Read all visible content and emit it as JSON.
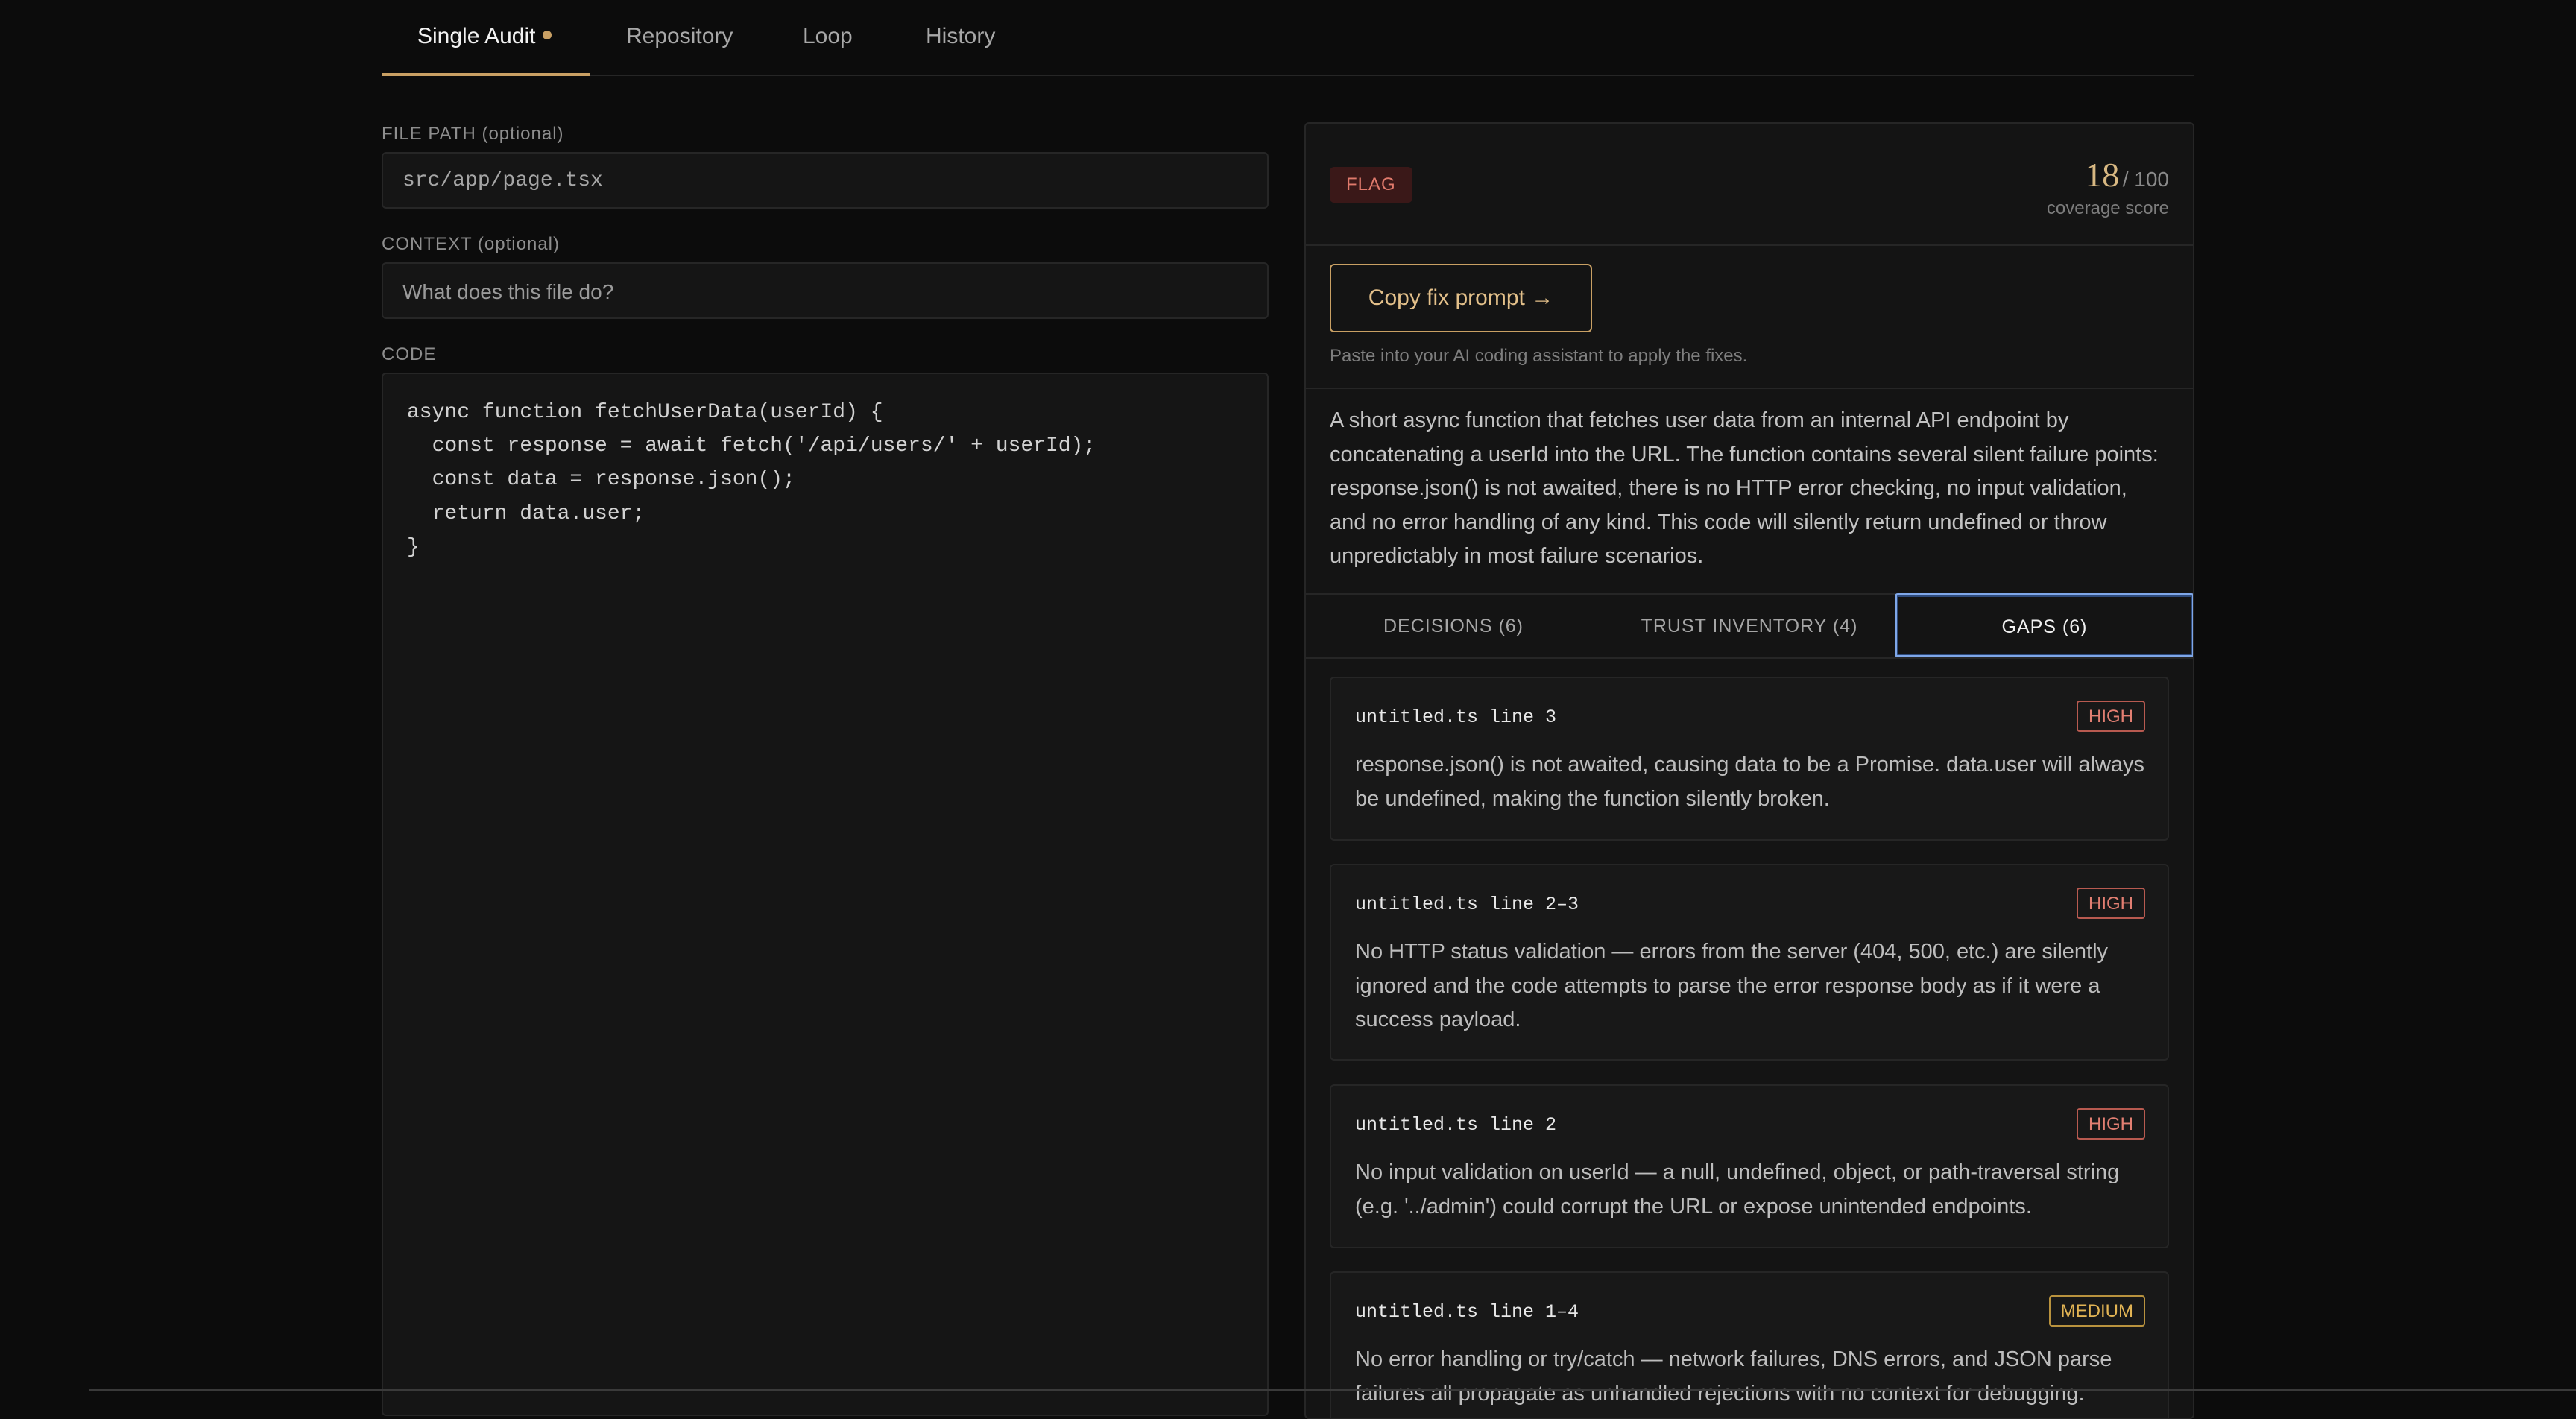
{
  "tabs": [
    {
      "label": "Single Audit",
      "active": true,
      "dot": true
    },
    {
      "label": "Repository"
    },
    {
      "label": "Loop"
    },
    {
      "label": "History"
    }
  ],
  "file_path": {
    "label": "FILE PATH (optional)",
    "value": "src/app/page.tsx"
  },
  "context": {
    "label": "CONTEXT (optional)",
    "placeholder": "What does this file do?"
  },
  "code": {
    "label": "CODE",
    "lines": [
      "async function fetchUserData(userId) {",
      "  const response = await fetch('/api/users/' + userId);",
      "  const data = response.json();",
      "  return data.user;",
      "}"
    ]
  },
  "result": {
    "badge": "FLAG",
    "score": "18",
    "score_max": "/ 100",
    "score_label": "coverage score",
    "copy_button": "Copy fix prompt →",
    "copy_hint": "Paste into your AI coding assistant to apply the fixes.",
    "summary": "A short async function that fetches user data from an internal API endpoint by concatenating a userId into the URL. The function contains several silent failure points: response.json() is not awaited, there is no HTTP error checking, no input validation, and no error handling of any kind. This code will silently return undefined or throw unpredictably in most failure scenarios.",
    "sub_tabs": [
      "DECISIONS (6)",
      "TRUST INVENTORY (4)",
      "GAPS (6)"
    ],
    "gaps": [
      {
        "location": "untitled.ts line 3",
        "severity": "HIGH",
        "description": "response.json() is not awaited, causing data to be a Promise. data.user will always be undefined, making the function silently broken."
      },
      {
        "location": "untitled.ts line 2–3",
        "severity": "HIGH",
        "description": "No HTTP status validation — errors from the server (404, 500, etc.) are silently ignored and the code attempts to parse the error response body as if it were a success payload."
      },
      {
        "location": "untitled.ts line 2",
        "severity": "HIGH",
        "description": "No input validation on userId — a null, undefined, object, or path-traversal string (e.g. '../admin') could corrupt the URL or expose unintended endpoints."
      },
      {
        "location": "untitled.ts line 1–4",
        "severity": "MEDIUM",
        "description": "No error handling or try/catch — network failures, DNS errors, and JSON parse failures all propagate as unhandled rejections with no context for debugging."
      }
    ]
  },
  "colors": {
    "accent": "#c9a064",
    "high": "#e27f72",
    "medium": "#e2b454",
    "focus": "#7fa7e8"
  }
}
